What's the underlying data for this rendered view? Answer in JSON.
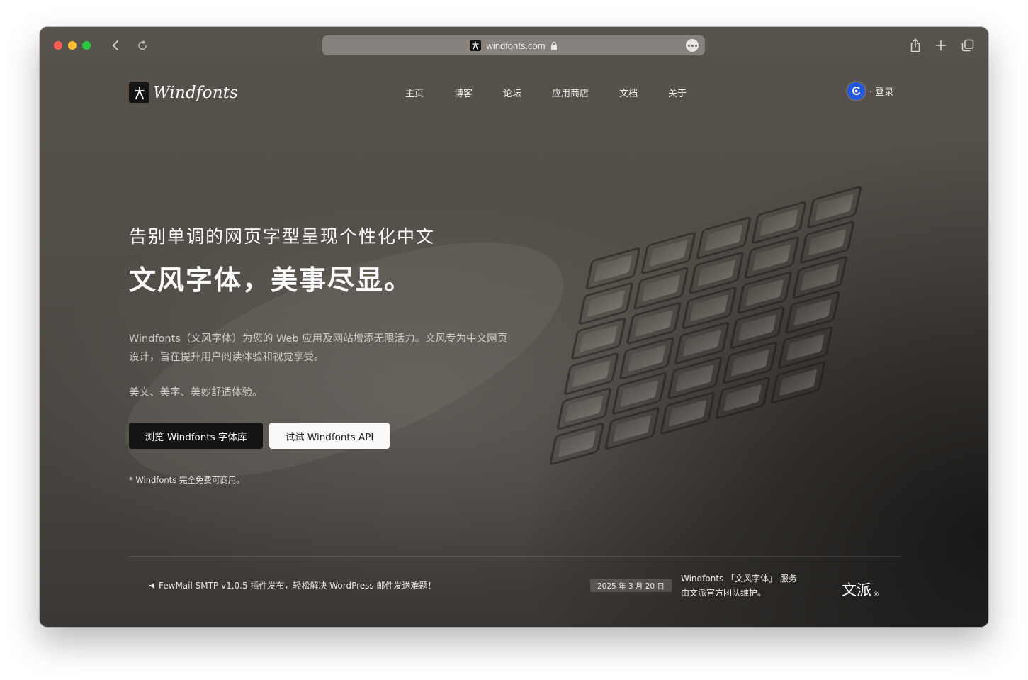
{
  "browser": {
    "url": "windfonts.com",
    "icons": {
      "back": "chevron-left-icon",
      "reload": "reload-icon",
      "lock": "lock-icon",
      "more": "ellipsis-icon",
      "share": "share-icon",
      "new_tab": "plus-icon",
      "tabs": "tabs-overview-icon"
    }
  },
  "header": {
    "logo_text": "Windfonts",
    "nav": [
      "主页",
      "博客",
      "论坛",
      "应用商店",
      "文档",
      "关于"
    ],
    "login_label": "· 登录"
  },
  "hero": {
    "subtitle": "告别单调的网页字型呈现个性化中文",
    "title": "文风字体，美事尽显。",
    "description": "Windfonts（文风字体）为您的 Web 应用及网站增添无限活力。文风专为中文网页设计，旨在提升用户阅读体验和视觉享受。",
    "tagline": "美文、美字、美妙舒适体验。",
    "primary_button": "浏览 Windfonts 字体库",
    "secondary_button": "试试 Windfonts API",
    "note": "* Windfonts 完全免费可商用。"
  },
  "footer": {
    "announcement": "FewMail SMTP v1.0.5 插件发布，轻松解决 WordPress 邮件发送难题！",
    "date": "2025 年 3 月 20 日",
    "service_line1": "Windfonts 「文风字体」 服务",
    "service_line2": "由文派官方团队维护。",
    "brand": "文派",
    "brand_mark": "®"
  },
  "colors": {
    "accent_login_badge": "#2257e0",
    "dark_button": "#141414"
  }
}
